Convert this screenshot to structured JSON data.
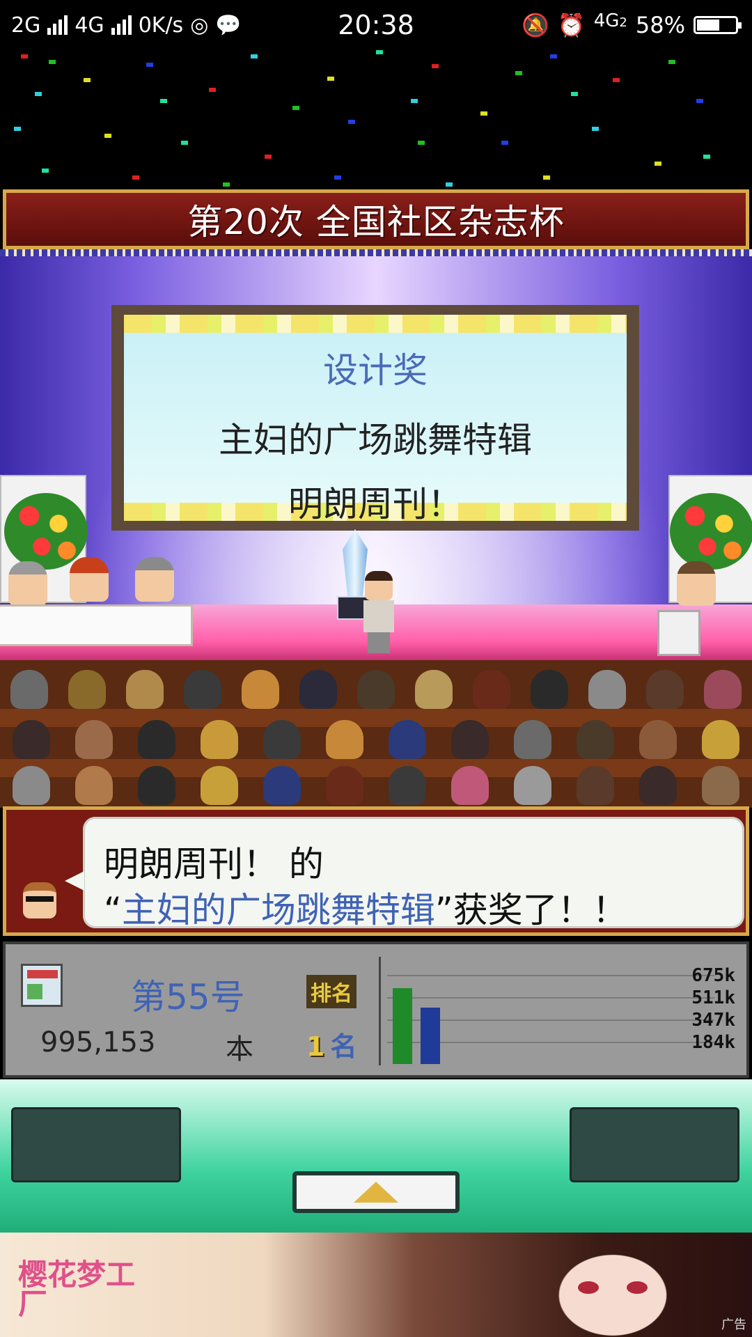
{
  "status_bar": {
    "network_left": "2G",
    "network_mid": "4G",
    "speed": "0K/s",
    "time": "20:38",
    "network_right": "4G",
    "network_right_sub": "2",
    "battery": "58%"
  },
  "event": {
    "title": "第20次 全国社区杂志杯"
  },
  "award_board": {
    "award_name": "设计奖",
    "article": "主妇的广场跳舞特辑",
    "magazine": "明朗周刊！"
  },
  "dialog": {
    "line1": "明朗周刊！ 的",
    "open_quote": "“",
    "highlight": "主妇的广场跳舞特辑",
    "close_quote": "”获奖了！！"
  },
  "info_panel": {
    "issue": "第55号",
    "copies": "995,153",
    "copies_unit": "本",
    "rank_label": "排名",
    "rank_number": "1",
    "rank_unit": "名",
    "chart_ticks": [
      "675k",
      "511k",
      "347k",
      "184k"
    ],
    "chart_bars": [
      {
        "value": 0.78,
        "color": "#1f8a2a"
      },
      {
        "value": 0.58,
        "color": "#203a9a"
      }
    ]
  },
  "ad": {
    "logo_text": "樱花梦工厂",
    "badge": "广告"
  },
  "colors": {
    "banner_red": "#7a1a12",
    "gold": "#d6a84a",
    "highlight_blue": "#3f63b4",
    "control_green": "#3fd3a0"
  },
  "icons": {
    "up": "up-triangle-icon",
    "alarm": "alarm-icon",
    "mute": "mute-bell-icon",
    "wechat": "wechat-icon",
    "hotspot": "hotspot-icon"
  }
}
